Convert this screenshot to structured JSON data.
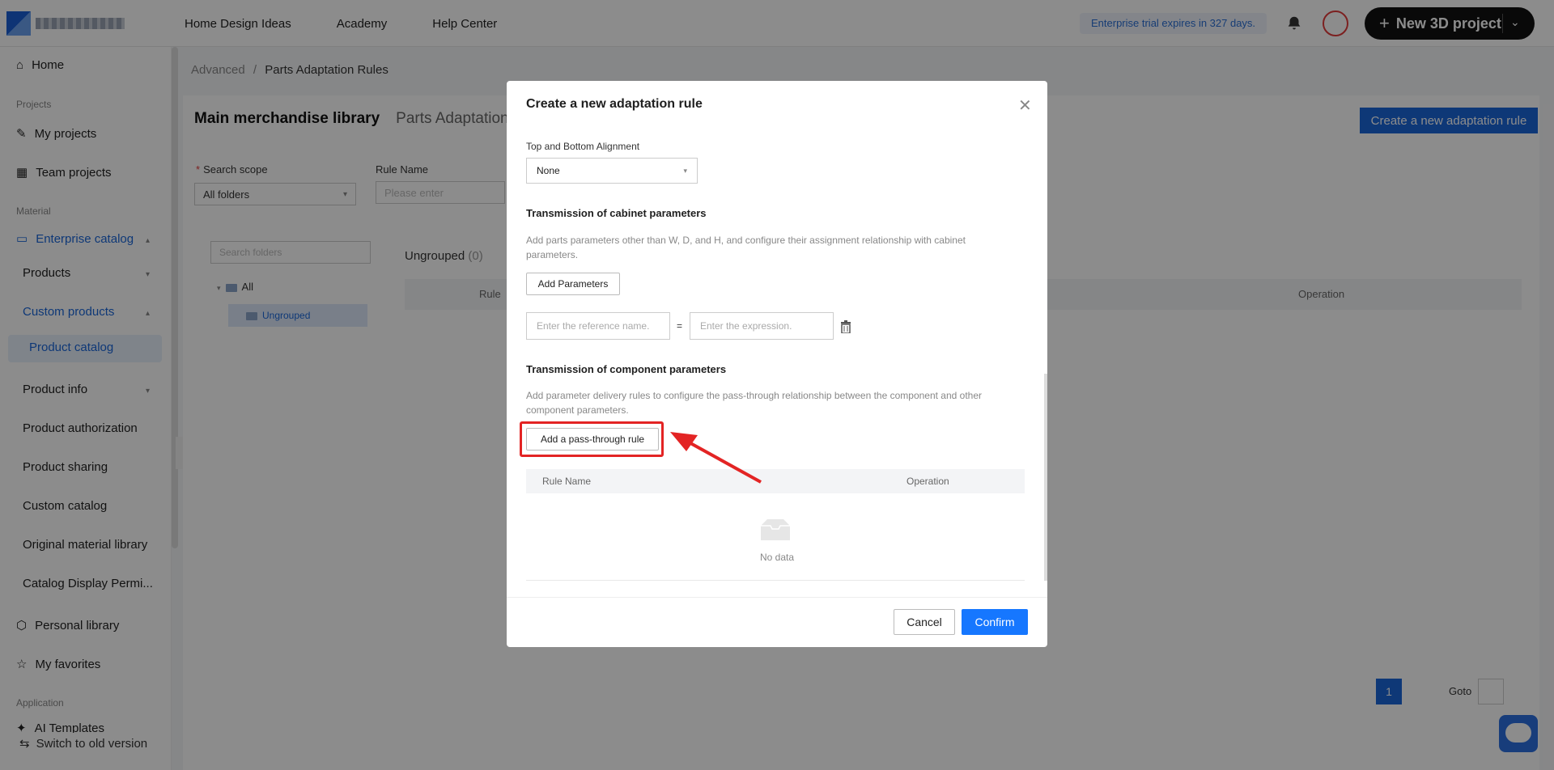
{
  "nav": {
    "items": [
      "Home Design Ideas",
      "Academy",
      "Help Center"
    ],
    "trial": "Enterprise trial expires in 327 days.",
    "new_project": "New 3D project"
  },
  "sidebar": {
    "home": "Home",
    "sec_projects": "Projects",
    "my_projects": "My projects",
    "team_projects": "Team projects",
    "sec_material": "Material",
    "enterprise_catalog": "Enterprise catalog",
    "products": "Products",
    "custom_products": "Custom products",
    "product_catalog": "Product catalog",
    "product_info": "Product info",
    "product_authorization": "Product authorization",
    "product_sharing": "Product sharing",
    "custom_catalog": "Custom catalog",
    "original_material": "Original material library",
    "catalog_display": "Catalog Display Permi...",
    "personal_library": "Personal library",
    "my_favorites": "My favorites",
    "sec_application": "Application",
    "ai_templates": "AI Templates",
    "switch_old": "Switch to old version"
  },
  "main": {
    "crumb_advanced": "Advanced",
    "crumb_sep": "/",
    "crumb_current": "Parts Adaptation Rules",
    "tab_main": "Main merchandise library",
    "tab_parts": "Parts Adaptation",
    "create_button": "Create a new adaptation rule",
    "search_scope_label": "Search scope",
    "search_scope_value": "All folders",
    "rule_name_label": "Rule Name",
    "rule_name_placeholder": "Please enter",
    "search_folders_placeholder": "Search folders",
    "tree_all": "All",
    "tree_ungrouped": "Ungrouped",
    "grid_title": "Ungrouped",
    "grid_count": "(0)",
    "col_rule": "Rule",
    "col_operation": "Operation",
    "page": "1",
    "goto": "Goto"
  },
  "modal": {
    "title": "Create a new adaptation rule",
    "align_label": "Top and Bottom Alignment",
    "align_value": "None",
    "cabinet_heading": "Transmission of cabinet parameters",
    "cabinet_desc": "Add parts parameters other than W, D, and H, and configure their assignment relationship with cabinet parameters.",
    "add_params": "Add Parameters",
    "ref_placeholder": "Enter the reference name.",
    "eq": "=",
    "expr_placeholder": "Enter the expression.",
    "component_heading": "Transmission of component parameters",
    "component_desc": "Add parameter delivery rules to configure the pass-through relationship between the component and other component parameters.",
    "add_pass": "Add a pass-through rule",
    "col_rule_name": "Rule Name",
    "col_operation": "Operation",
    "no_data": "No data",
    "cancel": "Cancel",
    "confirm": "Confirm"
  },
  "colors": {
    "primary": "#1677ff",
    "highlight": "#e32424"
  }
}
